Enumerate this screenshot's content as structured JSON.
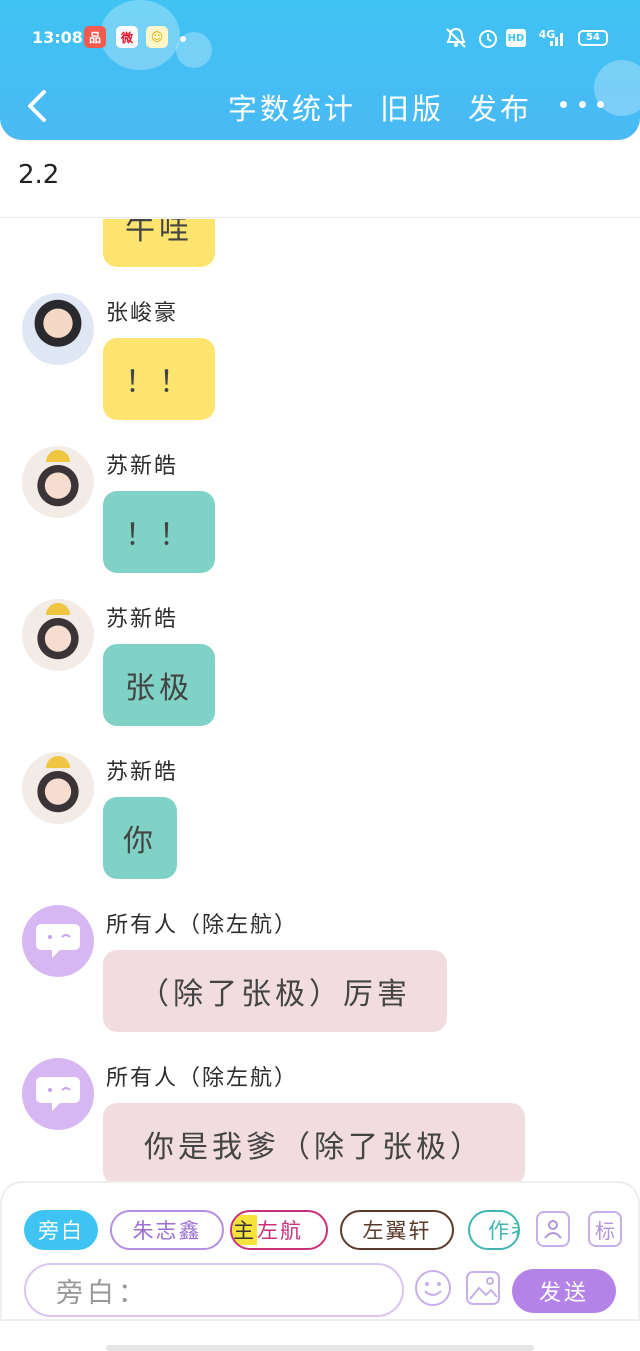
{
  "status_bar": {
    "time": "13:08",
    "network": "4G",
    "hd": "HD",
    "battery": "54"
  },
  "nav": {
    "word_count": "字数统计",
    "old_version": "旧版",
    "publish": "发布"
  },
  "title": "2.2",
  "messages": [
    {
      "sender": "",
      "text": "牛哇",
      "color": "yellow"
    },
    {
      "sender": "张峻豪",
      "text": "！！",
      "color": "yellow",
      "avatar": "boy"
    },
    {
      "sender": "苏新皓",
      "text": "！！",
      "color": "teal",
      "avatar": "su"
    },
    {
      "sender": "苏新皓",
      "text": "张极",
      "color": "teal",
      "avatar": "su"
    },
    {
      "sender": "苏新皓",
      "text": "你",
      "color": "teal",
      "avatar": "su"
    },
    {
      "sender": "所有人（除左航）",
      "text": "（除了张极）厉害",
      "color": "pink",
      "avatar": "all"
    },
    {
      "sender": "所有人（除左航）",
      "text": "你是我爹（除了张极）",
      "color": "pink",
      "avatar": "all"
    }
  ],
  "roles": {
    "narration": "旁白",
    "zhu_zhixin": "朱志鑫",
    "zuo_hang_prefix": "主",
    "zuo_hang": "左航",
    "zuo_yixuan": "左翼轩",
    "author": "作者"
  },
  "buttons": {
    "mark": "标",
    "send": "发送"
  },
  "input": {
    "placeholder": "旁白："
  },
  "colors": {
    "header": "#3fc3f3",
    "yellow_bubble": "#fde46f",
    "teal_bubble": "#80d2c6",
    "pink_bubble": "#f1dde0",
    "accent_purple": "#b483e8"
  }
}
